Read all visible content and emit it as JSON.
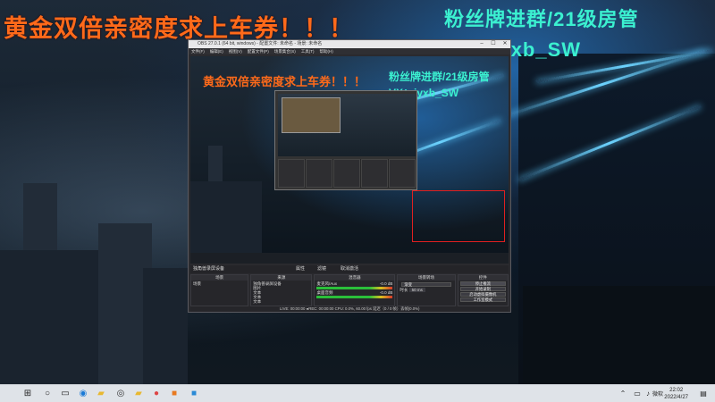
{
  "overlay": {
    "red_text": "黄金双倍亲密度求上车券！！！",
    "cyan_line1": "粉丝牌进群/21级房管",
    "cyan_line2": "VX：jyxb_SW"
  },
  "obs": {
    "title": "OBS 27.0.1 (64 bit, windows) - 配置文件: 未命名 - 场景: 未命名",
    "menu": [
      "文件(F)",
      "编辑(E)",
      "视图(V)",
      "配置文件(P)",
      "场景集合(S)",
      "工具(T)",
      "帮助(H)"
    ],
    "preview_overlay": {
      "red_text": "黄金双倍亲密度求上车券！！！",
      "cyan_line1": "粉丝牌进群/21级房管",
      "cyan_line2": "VX：jyxb_SW"
    },
    "control_row": {
      "source_label": "独角兽录屏设备",
      "properties": "属性",
      "filters": "滤镜",
      "deinterlace": "取消激活"
    },
    "docks": {
      "scenes": {
        "header": "场景",
        "items": [
          "场景"
        ]
      },
      "sources": {
        "header": "来源",
        "items": [
          "独角兽录屏设备",
          "图片",
          "文本",
          "文本",
          "文本",
          "窗口采集"
        ]
      },
      "mixer": {
        "header": "混音器",
        "channels": [
          {
            "name": "麦克风/Aux",
            "level": "-0.0 dB"
          },
          {
            "name": "桌面音频",
            "level": "-0.0 dB"
          }
        ]
      },
      "transitions": {
        "header": "场景转场",
        "type": "渐变",
        "duration_label": "时长",
        "duration": "50 ms"
      },
      "controls": {
        "header": "控件",
        "buttons": [
          "停止推流",
          "开始录制",
          "启动虚拟摄像机",
          "工作室模式",
          "设置",
          "退出"
        ]
      }
    },
    "status": "LIVE: 00:00:00  ●REC: 00:00:00  CPU: 0.0%, 60.00 fps  延迟（0 / 0 帧）丢帧(0.0%)"
  },
  "taskbar": {
    "ime": "微软",
    "time": "22:02",
    "date": "2022/4/27"
  }
}
